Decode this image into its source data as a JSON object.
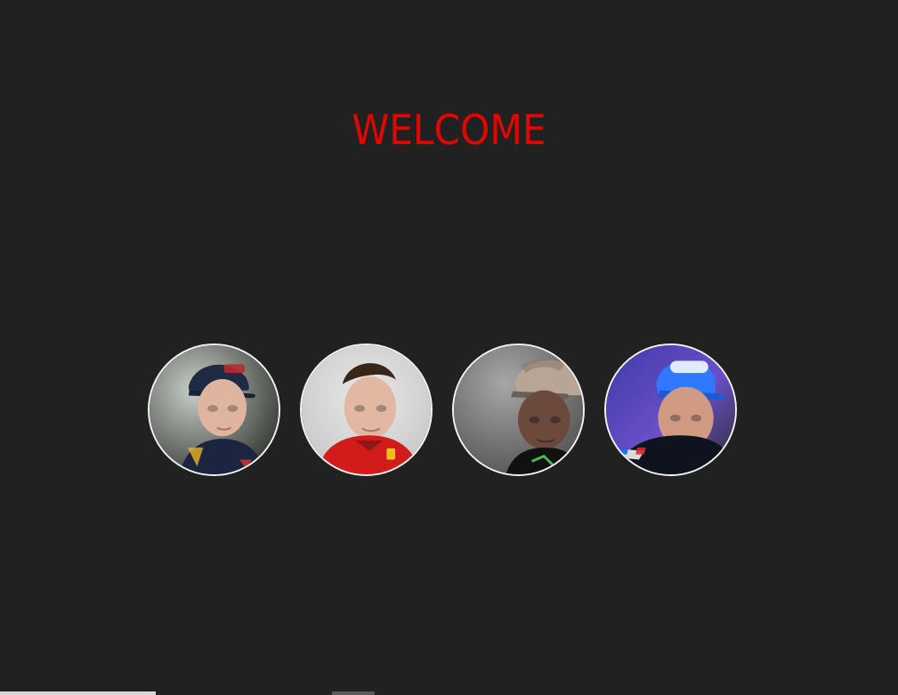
{
  "header": {
    "title": "WELCOME"
  },
  "colors": {
    "background": "#212121",
    "accent": "#e10600",
    "avatar_border": "#f2f2f2"
  },
  "drivers": [
    {
      "id": "max-verstappen",
      "avatar_icon": "driver-portrait-icon",
      "theme": "red-bull"
    },
    {
      "id": "charles-leclerc",
      "avatar_icon": "driver-portrait-icon",
      "theme": "ferrari"
    },
    {
      "id": "lewis-hamilton",
      "avatar_icon": "driver-portrait-icon",
      "theme": "mercedes"
    },
    {
      "id": "fernando-alonso",
      "avatar_icon": "driver-portrait-icon",
      "theme": "alpine"
    }
  ]
}
